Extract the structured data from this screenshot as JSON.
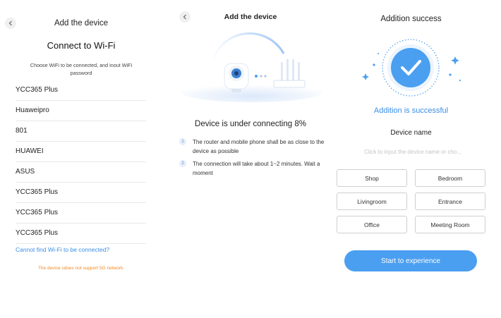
{
  "wifi_panel": {
    "title": "Add the device",
    "heading": "Connect to Wi-Fi",
    "hint": "Choose WiFi to be connected, and inout WiFi password",
    "networks": [
      "YCC365 Plus",
      "Huaweipro",
      "801",
      "HUAWEI",
      "ASUS",
      "YCC365 Plus",
      "YCC365 Plus",
      "YCC365 Plus"
    ],
    "cannot_find_link": "Cannot find Wi-Fi to be connected?",
    "warning": "The device sdoes not support 5G network.",
    "colors": {
      "link": "#3a8ee6",
      "warning": "#f08a24"
    }
  },
  "connecting_panel": {
    "title": "Add the device",
    "status": "Device is under connecting 8%",
    "progress_percent": 8,
    "tips": [
      {
        "num": "1",
        "text": "The router and mobile phone shall be as close to the device as possible"
      },
      {
        "num": "2",
        "text": "The connection will take about 1~2 minutes. Wait a moment"
      }
    ]
  },
  "success_panel": {
    "title": "Addition success",
    "success_text": "Addition is successful",
    "device_name_label": "Device name",
    "device_name_placeholder": "Click to input the device name or cho...",
    "rooms": [
      "Shop",
      "Bedroom",
      "Livingroom",
      "Entrance",
      "Office",
      "Meeting Room"
    ],
    "start_button": "Start to experience",
    "colors": {
      "accent": "#4a9ff0"
    }
  },
  "icons": [
    "back-arrow-icon",
    "camera-icon",
    "router-icon",
    "checkmark-icon"
  ]
}
